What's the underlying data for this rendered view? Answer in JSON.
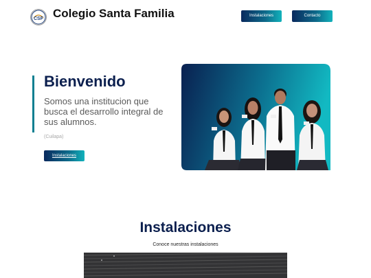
{
  "header": {
    "logo_icon": "school-crest-logo",
    "logo_letters": "CSF",
    "brand": "Colegio Santa Familia",
    "nav": {
      "instalaciones_label": "Instalaciones",
      "contacto_label": "Contacto"
    }
  },
  "hero": {
    "title": "Bienvenido",
    "text": "Somos una institucion que busca el desarrollo integral de sus alumnos.",
    "place": "(Cuilapa)",
    "button_label": "Instalaciones",
    "photo_subject": "students-group-photo"
  },
  "installations": {
    "title": "Instalaciones",
    "subtitle": "Conoce nuestras instalaciones",
    "photo_subject": "facility-roof-photo"
  },
  "colors": {
    "navy": "#0b1f4e",
    "teal": "#12b2bb",
    "accent_bar": "#0b7f91",
    "button_gradient_start": "#0a2a5e",
    "button_gradient_end": "#12b2bb",
    "muted_text": "#a7a7a7"
  }
}
